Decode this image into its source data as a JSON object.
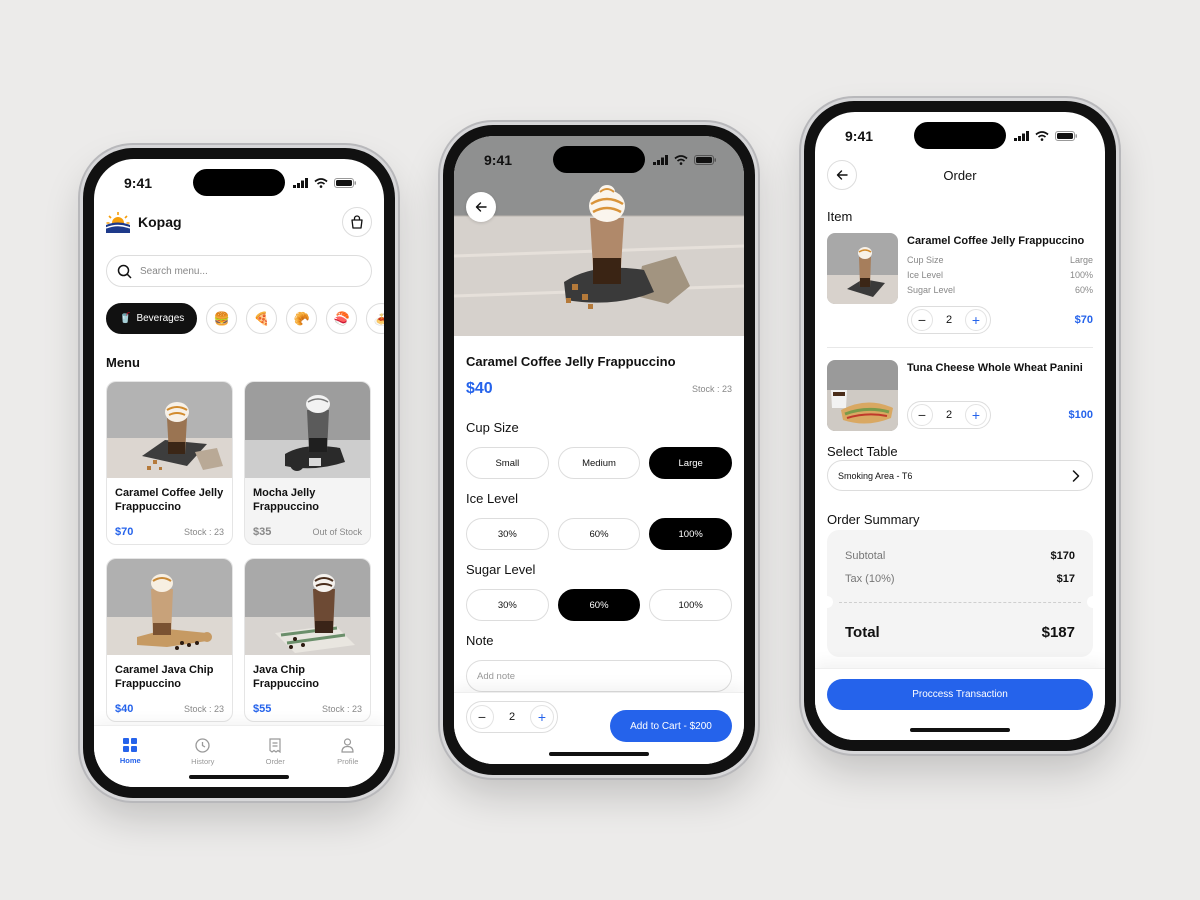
{
  "status_time": "9:41",
  "home": {
    "brand": "Kopag",
    "search_placeholder": "Search menu...",
    "categories": [
      {
        "label": "Beverages",
        "icon": "🥤",
        "active": true
      },
      {
        "label": "",
        "icon": "🍔"
      },
      {
        "label": "",
        "icon": "🍕"
      },
      {
        "label": "",
        "icon": "🥐"
      },
      {
        "label": "",
        "icon": "🍣"
      },
      {
        "label": "",
        "icon": "🍝"
      }
    ],
    "menu_title": "Menu",
    "items": [
      {
        "name": "Caramel Coffee Jelly Frappuccino",
        "price": "$70",
        "stock": "Stock : 23",
        "available": true
      },
      {
        "name": "Mocha Jelly Frappuccino",
        "price": "$35",
        "stock": "Out of Stock",
        "available": false
      },
      {
        "name": "Caramel Java Chip Frappuccino",
        "price": "$40",
        "stock": "Stock : 23",
        "available": true
      },
      {
        "name": "Java Chip Frappuccino",
        "price": "$55",
        "stock": "Stock : 23",
        "available": true
      }
    ],
    "tabs": [
      {
        "label": "Home",
        "icon": "grid-icon",
        "active": true
      },
      {
        "label": "History",
        "icon": "clock-icon"
      },
      {
        "label": "Order",
        "icon": "receipt-icon"
      },
      {
        "label": "Profile",
        "icon": "user-icon"
      }
    ]
  },
  "detail": {
    "title": "Caramel Coffee Jelly Frappuccino",
    "price": "$40",
    "stock": "Stock : 23",
    "cup_size_label": "Cup Size",
    "cup_sizes": [
      "Small",
      "Medium",
      "Large"
    ],
    "cup_size_selected": "Large",
    "ice_level_label": "Ice Level",
    "ice_levels": [
      "30%",
      "60%",
      "100%"
    ],
    "ice_level_selected": "100%",
    "sugar_level_label": "Sugar Level",
    "sugar_levels": [
      "30%",
      "60%",
      "100%"
    ],
    "sugar_level_selected": "60%",
    "note_label": "Note",
    "note_placeholder": "Add note",
    "quantity": "2",
    "add_to_cart": "Add to Cart - $200"
  },
  "order": {
    "title": "Order",
    "item_section": "Item",
    "items": [
      {
        "name": "Caramel Coffee Jelly Frappuccino",
        "attrs": [
          {
            "k": "Cup Size",
            "v": "Large"
          },
          {
            "k": "Ice Level",
            "v": "100%"
          },
          {
            "k": "Sugar Level",
            "v": "60%"
          }
        ],
        "qty": "2",
        "price": "$70"
      },
      {
        "name": "Tuna Cheese Whole Wheat Panini",
        "attrs": [],
        "qty": "2",
        "price": "$100"
      }
    ],
    "select_table_label": "Select Table",
    "table_value": "Smoking Area - T6",
    "summary_label": "Order Summary",
    "subtotal_label": "Subtotal",
    "subtotal": "$170",
    "tax_label": "Tax (10%)",
    "tax": "$17",
    "total_label": "Total",
    "total": "$187",
    "process_button": "Proccess Transaction"
  },
  "colors": {
    "accent": "#2563eb",
    "dark": "#000000"
  }
}
